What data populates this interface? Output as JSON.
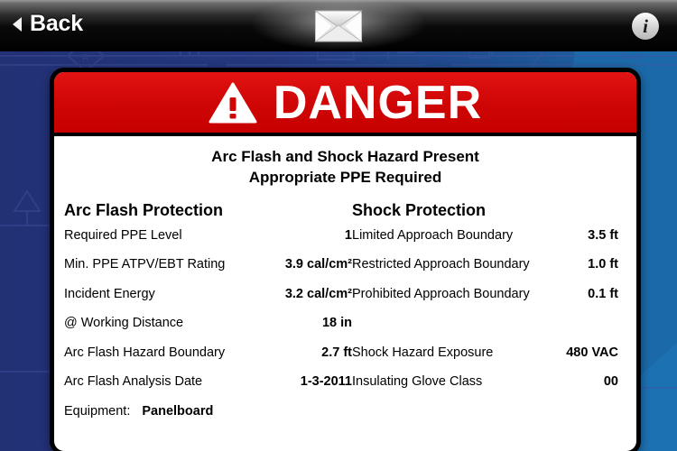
{
  "topbar": {
    "back_label": "Back",
    "back_icon": "left-triangle-icon",
    "mail_icon": "envelope-icon",
    "info_icon": "info-icon",
    "info_glyph": "i"
  },
  "card": {
    "banner": {
      "text": "DANGER",
      "icon": "warning-triangle-icon",
      "bg_color": "#d00606",
      "text_color": "#ffffff"
    },
    "subtitle_line1": "Arc Flash and Shock Hazard Present",
    "subtitle_line2": "Appropriate PPE Required",
    "left_column": {
      "heading": "Arc Flash Protection",
      "rows": [
        {
          "label": "Required PPE Level",
          "value": "1"
        },
        {
          "label": "Min. PPE ATPV/EBT Rating",
          "value": "3.9 cal/cm²"
        },
        {
          "label": "Incident Energy",
          "value": "3.2 cal/cm²"
        },
        {
          "label": "@ Working Distance",
          "value": "18 in"
        },
        {
          "label": "Arc Flash Hazard Boundary",
          "value": "2.7 ft"
        },
        {
          "label": "Arc Flash Analysis Date",
          "value": "1-3-2011"
        }
      ],
      "equipment_label": "Equipment:",
      "equipment_value": "Panelboard"
    },
    "right_column": {
      "heading": "Shock Protection",
      "rows": [
        {
          "label": "Limited Approach Boundary",
          "value": "3.5 ft"
        },
        {
          "label": "Restricted Approach Boundary",
          "value": "1.0 ft"
        },
        {
          "label": "Prohibited Approach Boundary",
          "value": "0.1 ft"
        },
        {
          "label": "Shock Hazard Exposure",
          "value": "480 VAC"
        },
        {
          "label": "Insulating Glove Class",
          "value": "00"
        }
      ]
    }
  },
  "colors": {
    "background_dark_blue": "#23357e",
    "background_light_blue": "#1b69a8",
    "danger_red": "#d00606",
    "card_white": "#ffffff",
    "topbar_black": "#0a0a0a"
  }
}
